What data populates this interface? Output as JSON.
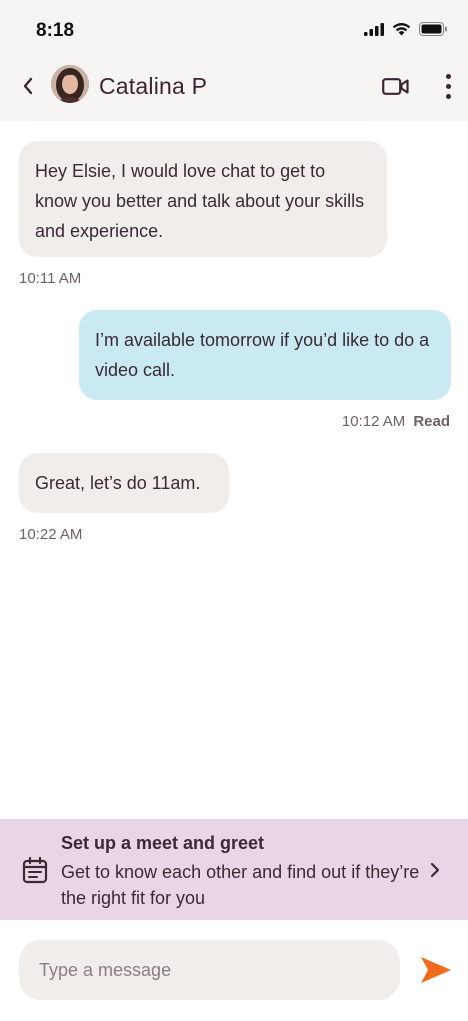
{
  "status_bar": {
    "time": "8:18"
  },
  "header": {
    "contact_name": "Catalina P"
  },
  "messages": [
    {
      "direction": "incoming",
      "text": "Hey Elsie, I would love chat to get to know you better and talk about your skills and experience.",
      "time": "10:11 AM"
    },
    {
      "direction": "outgoing",
      "text": "I’m available tomorrow if you’d like to do a video call.",
      "time": "10:12 AM",
      "status": "Read"
    },
    {
      "direction": "incoming",
      "text": "Great, let’s do 11am.",
      "time": "10:22 AM"
    }
  ],
  "meet_banner": {
    "title": "Set up a meet and greet",
    "description": "Get to know each other and find out if they’re the right fit for you",
    "icon": "calendar-icon"
  },
  "composer": {
    "placeholder": "Type a message",
    "value": ""
  },
  "colors": {
    "incoming_bubble": "#f0edeb",
    "outgoing_bubble": "#c9e9f3",
    "banner": "#e8d6e6",
    "send_accent": "#f26a1b",
    "header_bg": "#f7f5f4"
  }
}
